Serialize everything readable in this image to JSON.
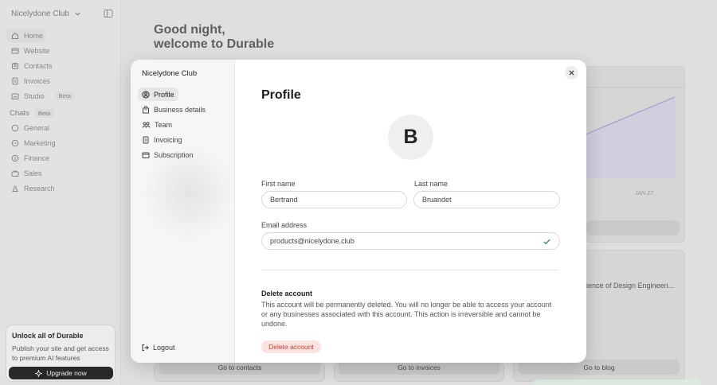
{
  "sidebar": {
    "workspace": "Nicelydone Club",
    "items": [
      {
        "label": "Home"
      },
      {
        "label": "Website"
      },
      {
        "label": "Contacts"
      },
      {
        "label": "Invoices"
      },
      {
        "label": "Studio",
        "badge": "Beta"
      }
    ],
    "chats": {
      "label": "Chats",
      "badge": "Beta",
      "items": [
        {
          "label": "General"
        },
        {
          "label": "Marketing"
        },
        {
          "label": "Finance"
        },
        {
          "label": "Sales"
        },
        {
          "label": "Research"
        }
      ]
    },
    "unlock": {
      "title": "Unlock all of Durable",
      "text": "Publish your site and get access to premium AI features",
      "button": "Upgrade now"
    }
  },
  "main": {
    "greeting_line1": "Good night,",
    "greeting_line2": "welcome to Durable",
    "chart_date": "JAN 27",
    "blog_text": "ience of Design Engineeri...",
    "buttons": {
      "contacts": "Go to contacts",
      "invoices": "Go to invoices",
      "blog": "Go to blog"
    }
  },
  "modal": {
    "sidebar_title": "Nicelydone Club",
    "nav": [
      {
        "label": "Profile"
      },
      {
        "label": "Business details"
      },
      {
        "label": "Team"
      },
      {
        "label": "Invoicing"
      },
      {
        "label": "Subscription"
      }
    ],
    "logout": "Logout",
    "title": "Profile",
    "avatar_initial": "B",
    "first_name_label": "First name",
    "first_name_value": "Bertrand",
    "last_name_label": "Last name",
    "last_name_value": "Bruandet",
    "email_label": "Email address",
    "email_value": "products@nicelydone.club",
    "delete_title": "Delete account",
    "delete_desc": "This account will be permanently deleted. You will no longer be able to access your account or any businesses associated with this account. This action is irreversible and cannot be undone.",
    "delete_button": "Delete account"
  },
  "icons": {
    "home": "home-icon",
    "website": "globe-icon",
    "contacts": "contacts-icon",
    "invoices": "invoice-icon",
    "studio": "studio-icon",
    "chat": "chat-icon",
    "close": "close-icon",
    "check": "check-icon",
    "logout": "logout-icon"
  },
  "colors": {
    "danger": "#d63a32",
    "danger_bg": "#fbe3e1",
    "chart_line": "#a9a3d6"
  }
}
